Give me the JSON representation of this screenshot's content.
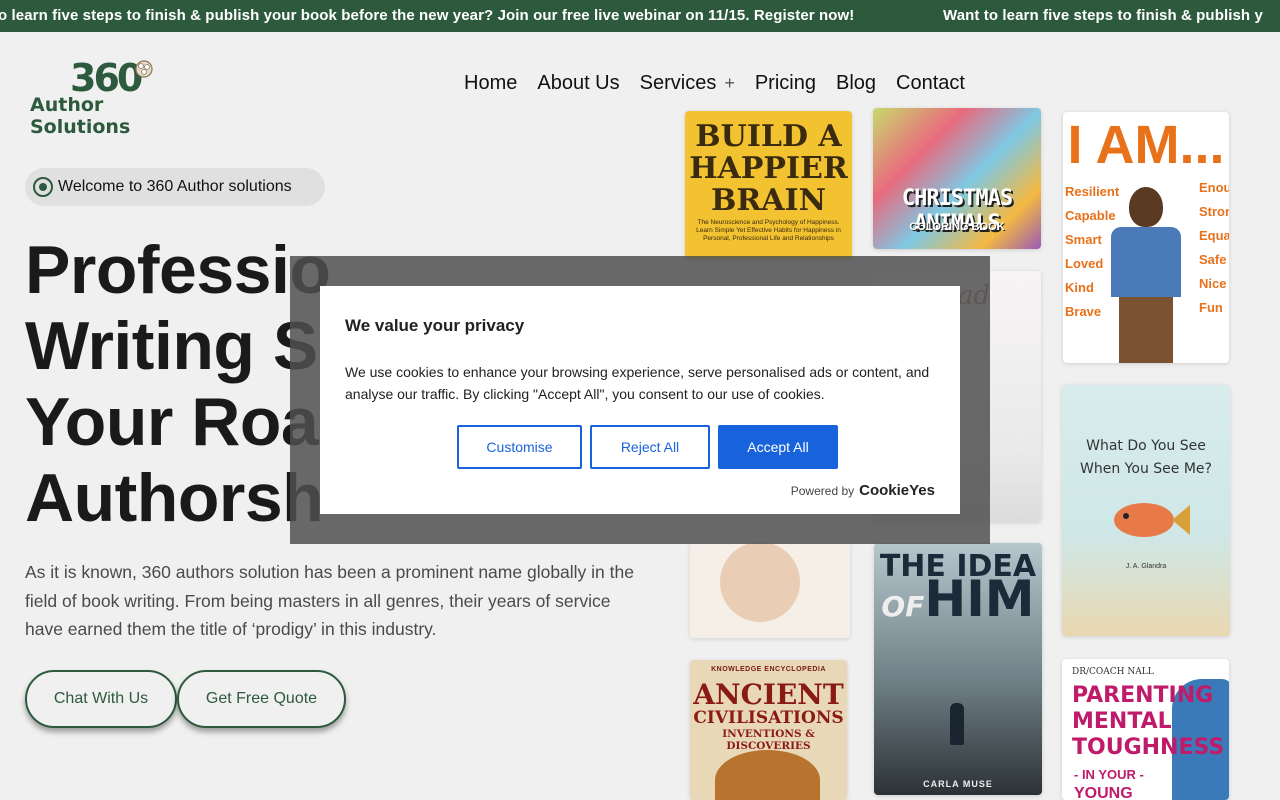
{
  "announcement": {
    "text": "Want to learn five steps to finish & publish your book before the new year? Join our free live webinar on 11/15. Register now!",
    "visible_start": "o learn five steps to finish & publish your book before the new year? Join our free live webinar on 11/15. Register now!",
    "visible_end": "Want to learn five steps to finish & publish y"
  },
  "logo": {
    "number": "360",
    "name": "Author Solutions"
  },
  "nav": {
    "home": "Home",
    "about": "About Us",
    "services": "Services",
    "services_plus": "+",
    "pricing": "Pricing",
    "blog": "Blog",
    "contact": "Contact"
  },
  "hero": {
    "badge": "Welcome to 360 Author solutions",
    "title_lines": [
      "Professional Book",
      "Writing Services:",
      "Your Road to",
      "Authorship"
    ],
    "visible_title_lines": [
      "Professio",
      "Writing S",
      "Your Roa",
      "Authorsh"
    ],
    "description": "As it is known, 360 authors solution has been a prominent name globally in the field of book writing. From being masters in all genres, their years of service have earned them the title of ‘prodigy’ in this industry.",
    "chat_button": "Chat With Us",
    "quote_button": "Get Free Quote"
  },
  "books": {
    "b1_line1": "BUILD A",
    "b1_line2": "HAPPIER",
    "b1_line3": "BRAIN",
    "b1_sub": "The Neuroscience and Psychology of Happiness. Learn Simple Yet Effective Habits for Happiness in Personal, Professional Life and Relationships",
    "b2_title": "CHRISTMAS ANIMALS",
    "b2_sub": "COLORING BOOK",
    "b3_title": "I AM...",
    "b3_words": [
      "Resilient",
      "Capable",
      "Smart",
      "Loved",
      "Kind",
      "Brave",
      "Enough",
      "Strong",
      "Equal",
      "Safe",
      "Nice",
      "Fun"
    ],
    "b4_partial": "g  ad",
    "b5_line1": "What Do You See",
    "b5_line2": "When You See Me?",
    "b5_author": "J. A. Glandra",
    "b6_line1": "THE IDEA",
    "b6_line2": "OF",
    "b6_line3": "HIM",
    "b6_author": "CARLA MUSE",
    "b7_top": "KNOWLEDGE ENCYCLOPEDIA",
    "b7_line1": "ANCIENT",
    "b7_line2": "CIVILISATIONS",
    "b7_line3": "INVENTIONS & DISCOVERIES",
    "b8_author": "DR/COACH NALL",
    "b8_line1": "PARENTING",
    "b8_line2": "MENTAL",
    "b8_line3": "TOUGHNESS",
    "b8_line4": "- IN YOUR -",
    "b8_line5": "YOUNG"
  },
  "cookie": {
    "title": "We value your privacy",
    "body": "We use cookies to enhance your browsing experience, serve personalised ads or content, and analyse our traffic. By clicking \"Accept All\", you consent to our use of cookies.",
    "customise": "Customise",
    "reject": "Reject All",
    "accept": "Accept All",
    "powered_by": "Powered by",
    "brand": "CookieYes"
  },
  "colors": {
    "brand_green": "#2d5a3d",
    "cookie_blue": "#1863dc"
  }
}
